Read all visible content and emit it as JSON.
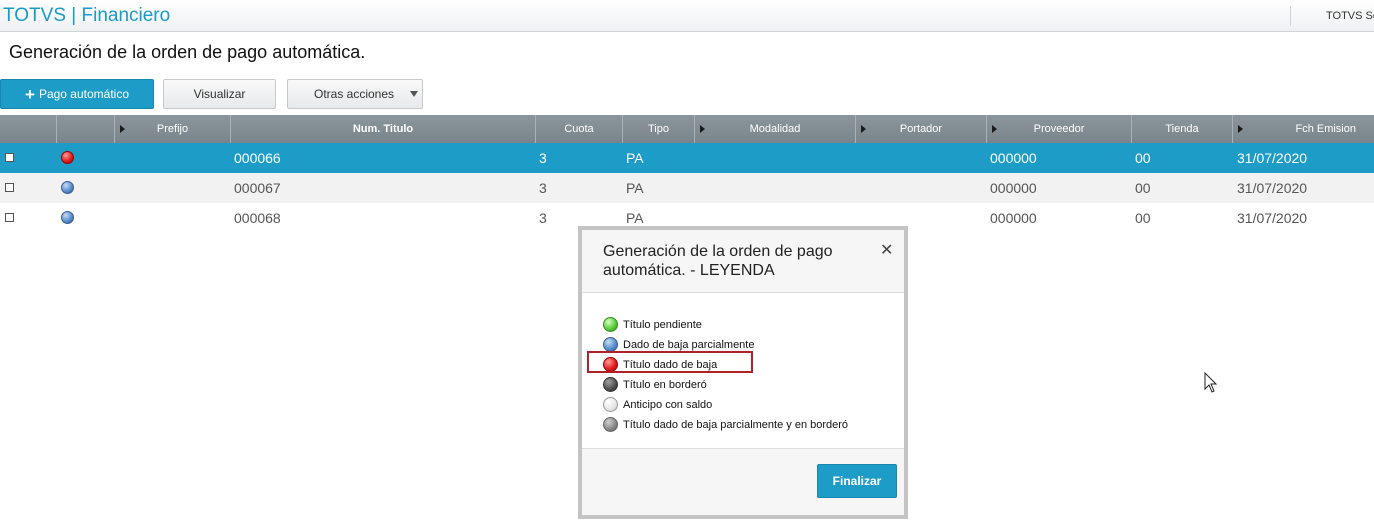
{
  "app": {
    "title": "TOTVS | Financiero",
    "right_label": "TOTVS Se"
  },
  "page": {
    "title": "Generación de la orden de pago automática."
  },
  "toolbar": {
    "primary_label": "Pago automático",
    "primary_icon": "plus-icon",
    "visualizar_label": "Visualizar",
    "otras_label": "Otras acciones"
  },
  "grid": {
    "headers": [
      "Prefijo",
      "Num. Titulo",
      "Cuota",
      "Tipo",
      "Modalidad",
      "Portador",
      "Proveedor",
      "Tienda",
      "Fch Emision"
    ],
    "rows": [
      {
        "status": "red",
        "prefijo": "",
        "num_titulo": "000066",
        "cuota": "3",
        "tipo": "PA",
        "modalidad": "",
        "portador": "",
        "proveedor": "000000",
        "tienda": "00",
        "fecha": "31/07/2020",
        "selected": true
      },
      {
        "status": "blue",
        "prefijo": "",
        "num_titulo": "000067",
        "cuota": "3",
        "tipo": "PA",
        "modalidad": "",
        "portador": "",
        "proveedor": "000000",
        "tienda": "00",
        "fecha": "31/07/2020",
        "selected": false
      },
      {
        "status": "blue",
        "prefijo": "",
        "num_titulo": "000068",
        "cuota": "3",
        "tipo": "PA",
        "modalidad": "",
        "portador": "",
        "proveedor": "000000",
        "tienda": "00",
        "fecha": "31/07/2020",
        "selected": false
      }
    ]
  },
  "modal": {
    "title": "Generación de la orden de pago automática. - LEYENDA",
    "close_icon": "close-icon",
    "items": [
      {
        "color": "green",
        "label": "Título pendiente"
      },
      {
        "color": "blue",
        "label": "Dado de baja parcialmente"
      },
      {
        "color": "red",
        "label": "Título dado de baja"
      },
      {
        "color": "dark",
        "label": "Título en borderó"
      },
      {
        "color": "white",
        "label": "Anticipo con saldo"
      },
      {
        "color": "gray",
        "label": "Título dado de baja parcialmente y en borderó"
      }
    ],
    "highlighted_item": "Título dado de baja",
    "finalizar_label": "Finalizar"
  },
  "colors": {
    "accent": "#1e9cc8",
    "header_bg": "#7f8a90",
    "highlight_border": "#b0212b"
  }
}
